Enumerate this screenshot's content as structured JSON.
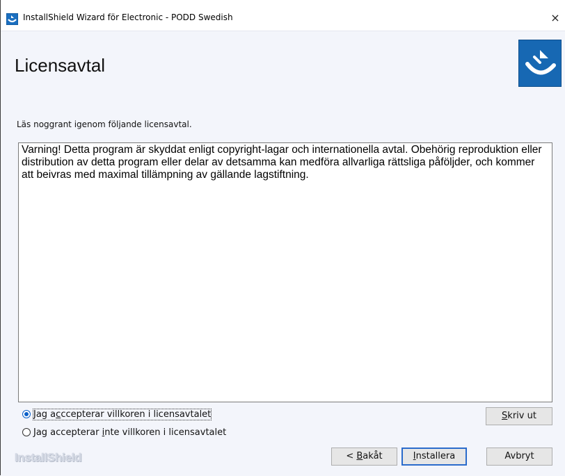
{
  "window": {
    "title": "InstallShield Wizard för Electronic - PODD Swedish",
    "close_symbol": "×",
    "app_icon": "installshield-app-icon"
  },
  "header": {
    "title": "Licensavtal",
    "logo_icon": "installshield-logo-icon"
  },
  "instruction": "Läs noggrant igenom följande licensavtal.",
  "license": {
    "text": "Varning! Detta program är skyddat enligt copyright-lagar och internationella avtal. Obehörig reproduktion eller distribution av detta program eller delar av detsamma kan medföra allvarliga rättsliga påföljder, och kommer att beivras med maximal tillämpning av gällande lagstiftning."
  },
  "options": {
    "accept": {
      "before": "Jag a",
      "mnemonic": "c",
      "after": "ccepterar villkoren i licensavtalet",
      "selected": true
    },
    "decline": {
      "before": "Jag accepterar ",
      "mnemonic": "i",
      "after": "nte villkoren i licensavtalet",
      "selected": false
    }
  },
  "brand_text": "InstallShield",
  "buttons": {
    "print": {
      "mnemonic": "S",
      "rest": "kriv ut"
    },
    "back": {
      "prefix": "< ",
      "mnemonic": "B",
      "rest": "akåt"
    },
    "install": {
      "mnemonic": "I",
      "rest": "nstallera"
    },
    "cancel": {
      "label": "Avbryt"
    }
  },
  "colors": {
    "accent": "#0a5fc8",
    "logo_blue": "#1768b3",
    "panel_bg": "#f3f5fb"
  }
}
